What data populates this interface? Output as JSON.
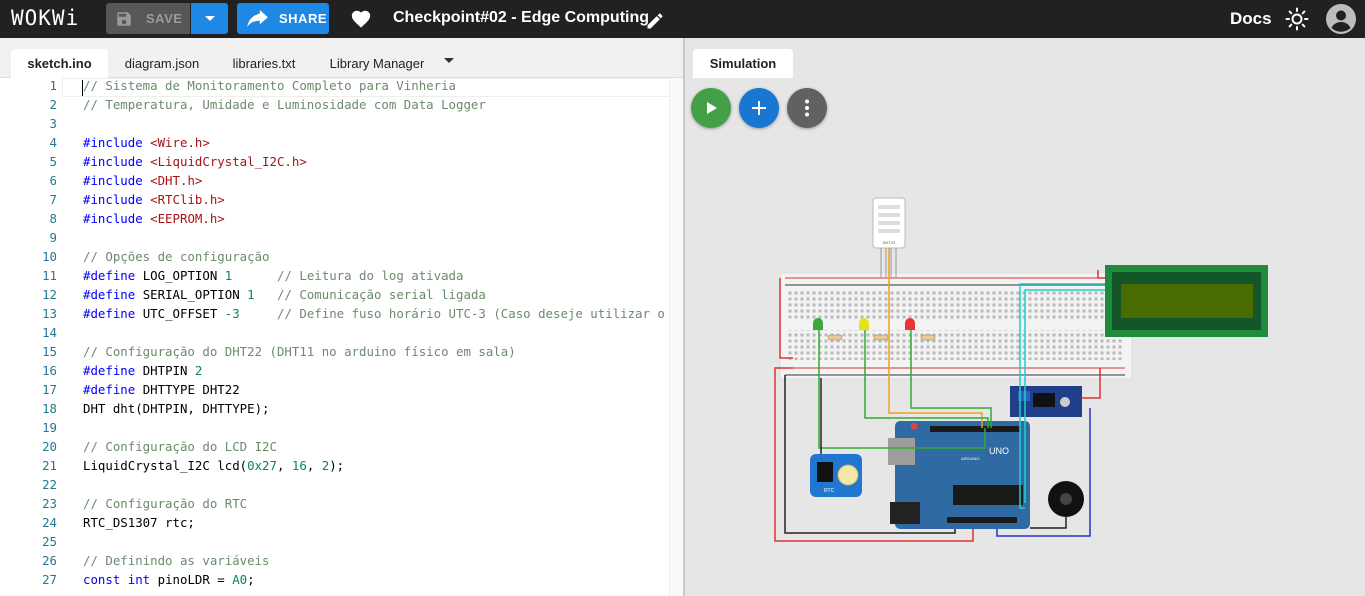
{
  "header": {
    "logo": "WOKWi",
    "save_label": "SAVE",
    "share_label": "SHARE",
    "project_title": "Checkpoint#02 - Edge Computing",
    "docs_label": "Docs"
  },
  "editor": {
    "tabs": [
      {
        "label": "sketch.ino",
        "active": true
      },
      {
        "label": "diagram.json",
        "active": false
      },
      {
        "label": "libraries.txt",
        "active": false
      },
      {
        "label": "Library Manager",
        "active": false
      }
    ],
    "lines": [
      {
        "n": "1",
        "parts": [
          [
            "com",
            "// Sistema de Monitoramento Completo para Vinheria"
          ]
        ]
      },
      {
        "n": "2",
        "parts": [
          [
            "com",
            "// Temperatura, Umidade e Luminosidade com Data Logger"
          ]
        ]
      },
      {
        "n": "3",
        "parts": []
      },
      {
        "n": "4",
        "parts": [
          [
            "kw",
            "#include "
          ],
          [
            "str",
            "<Wire.h>"
          ]
        ]
      },
      {
        "n": "5",
        "parts": [
          [
            "kw",
            "#include "
          ],
          [
            "str",
            "<LiquidCrystal_I2C.h>"
          ]
        ]
      },
      {
        "n": "6",
        "parts": [
          [
            "kw",
            "#include "
          ],
          [
            "str",
            "<DHT.h>"
          ]
        ]
      },
      {
        "n": "7",
        "parts": [
          [
            "kw",
            "#include "
          ],
          [
            "str",
            "<RTClib.h>"
          ]
        ]
      },
      {
        "n": "8",
        "parts": [
          [
            "kw",
            "#include "
          ],
          [
            "str",
            "<EEPROM.h>"
          ]
        ]
      },
      {
        "n": "9",
        "parts": []
      },
      {
        "n": "10",
        "parts": [
          [
            "com",
            "// Opções de configuração"
          ]
        ]
      },
      {
        "n": "11",
        "parts": [
          [
            "kw",
            "#define "
          ],
          [
            "txt",
            "LOG_OPTION "
          ],
          [
            "num",
            "1"
          ],
          [
            "txt",
            "      "
          ],
          [
            "com",
            "// Leitura do log ativada"
          ]
        ]
      },
      {
        "n": "12",
        "parts": [
          [
            "kw",
            "#define "
          ],
          [
            "txt",
            "SERIAL_OPTION "
          ],
          [
            "num",
            "1"
          ],
          [
            "txt",
            "   "
          ],
          [
            "com",
            "// Comunicação serial ligada"
          ]
        ]
      },
      {
        "n": "13",
        "parts": [
          [
            "kw",
            "#define "
          ],
          [
            "txt",
            "UTC_OFFSET "
          ],
          [
            "num",
            "-3"
          ],
          [
            "txt",
            "     "
          ],
          [
            "com",
            "// Define fuso horário UTC-3 (Caso deseje utilizar o"
          ]
        ]
      },
      {
        "n": "14",
        "parts": []
      },
      {
        "n": "15",
        "parts": [
          [
            "com",
            "// Configuração do DHT22 (DHT11 no arduino físico em sala)"
          ]
        ]
      },
      {
        "n": "16",
        "parts": [
          [
            "kw",
            "#define "
          ],
          [
            "txt",
            "DHTPIN "
          ],
          [
            "num",
            "2"
          ]
        ]
      },
      {
        "n": "17",
        "parts": [
          [
            "kw",
            "#define "
          ],
          [
            "txt",
            "DHTTYPE DHT22"
          ]
        ]
      },
      {
        "n": "18",
        "parts": [
          [
            "txt",
            "DHT dht(DHTPIN, DHTTYPE);"
          ]
        ]
      },
      {
        "n": "19",
        "parts": []
      },
      {
        "n": "20",
        "parts": [
          [
            "com",
            "// Configuração do LCD I2C"
          ]
        ]
      },
      {
        "n": "21",
        "parts": [
          [
            "txt",
            "LiquidCrystal_I2C lcd("
          ],
          [
            "num",
            "0x27"
          ],
          [
            "txt",
            ", "
          ],
          [
            "num",
            "16"
          ],
          [
            "txt",
            ", "
          ],
          [
            "num",
            "2"
          ],
          [
            "txt",
            ");"
          ]
        ]
      },
      {
        "n": "22",
        "parts": []
      },
      {
        "n": "23",
        "parts": [
          [
            "com",
            "// Configuração do RTC"
          ]
        ]
      },
      {
        "n": "24",
        "parts": [
          [
            "txt",
            "RTC_DS1307 rtc;"
          ]
        ]
      },
      {
        "n": "25",
        "parts": []
      },
      {
        "n": "26",
        "parts": [
          [
            "com",
            "// Definindo as variáveis"
          ]
        ]
      },
      {
        "n": "27",
        "parts": [
          [
            "kw",
            "const int "
          ],
          [
            "txt",
            "pinoLDR = "
          ],
          [
            "num",
            "A0"
          ],
          [
            "txt",
            ";"
          ]
        ]
      }
    ]
  },
  "simulation": {
    "tab_label": "Simulation",
    "board_label": "UNO",
    "board_sublabel": "ARDUINO",
    "dht_label": "DHT22",
    "rtc_label": "RTC"
  },
  "colors": {
    "topbar": "#212121",
    "accent": "#1e88e5",
    "play": "#43a047",
    "board": "#2f6aa3",
    "lcd_frame": "#1e8c3c",
    "lcd_screen": "#4a6b00"
  },
  "icons": {
    "save": "save-icon",
    "share": "share-arrow-icon",
    "favorite": "heart-icon",
    "edit": "pencil-icon",
    "theme": "sun-icon",
    "account": "account-icon",
    "play": "play-icon",
    "add": "plus-icon",
    "more": "more-vertical-icon"
  }
}
